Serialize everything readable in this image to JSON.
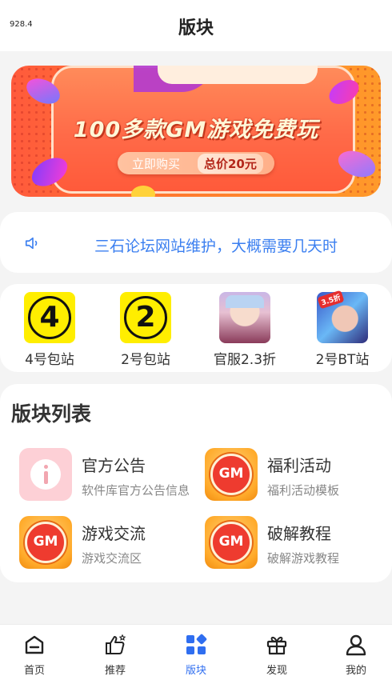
{
  "status": {
    "text": "928.4"
  },
  "header": {
    "title": "版块"
  },
  "banner": {
    "title": "100多款GM游戏免费玩",
    "buy_label": "立即购买",
    "price_label": "总价20元"
  },
  "notice": {
    "icon": "speaker-icon",
    "text": "三石论坛网站维护，大概需要几天时"
  },
  "quick_links": [
    {
      "label": "4号包站",
      "badge": "4",
      "icon": "number-4-badge-icon"
    },
    {
      "label": "2号包站",
      "badge": "2",
      "icon": "number-2-badge-icon"
    },
    {
      "label": "官服2.3折",
      "icon": "game-avatar-icon"
    },
    {
      "label": "2号BT站",
      "badge": "3.5折",
      "icon": "game-avatar-icon"
    }
  ],
  "boards": {
    "title": "版块列表",
    "items": [
      {
        "name": "官方公告",
        "desc": "软件库官方公告信息",
        "icon": "info-icon"
      },
      {
        "name": "福利活动",
        "desc": "福利活动模板",
        "icon": "gm-icon",
        "icon_text": "GM"
      },
      {
        "name": "游戏交流",
        "desc": "游戏交流区",
        "icon": "gm-icon",
        "icon_text": "GM"
      },
      {
        "name": "破解教程",
        "desc": "破解游戏教程",
        "icon": "gm-icon",
        "icon_text": "GM"
      }
    ]
  },
  "tabbar": {
    "items": [
      {
        "label": "首页",
        "icon": "home-icon"
      },
      {
        "label": "推荐",
        "icon": "thumbs-up-icon"
      },
      {
        "label": "版块",
        "icon": "grid-icon",
        "active": true
      },
      {
        "label": "发现",
        "icon": "gift-icon"
      },
      {
        "label": "我的",
        "icon": "user-icon"
      }
    ],
    "active_color": "#2f6ef0"
  },
  "colors": {
    "accent": "#2f6ef0",
    "notice_text": "#3b7ff0",
    "banner": "#ff6a48"
  }
}
